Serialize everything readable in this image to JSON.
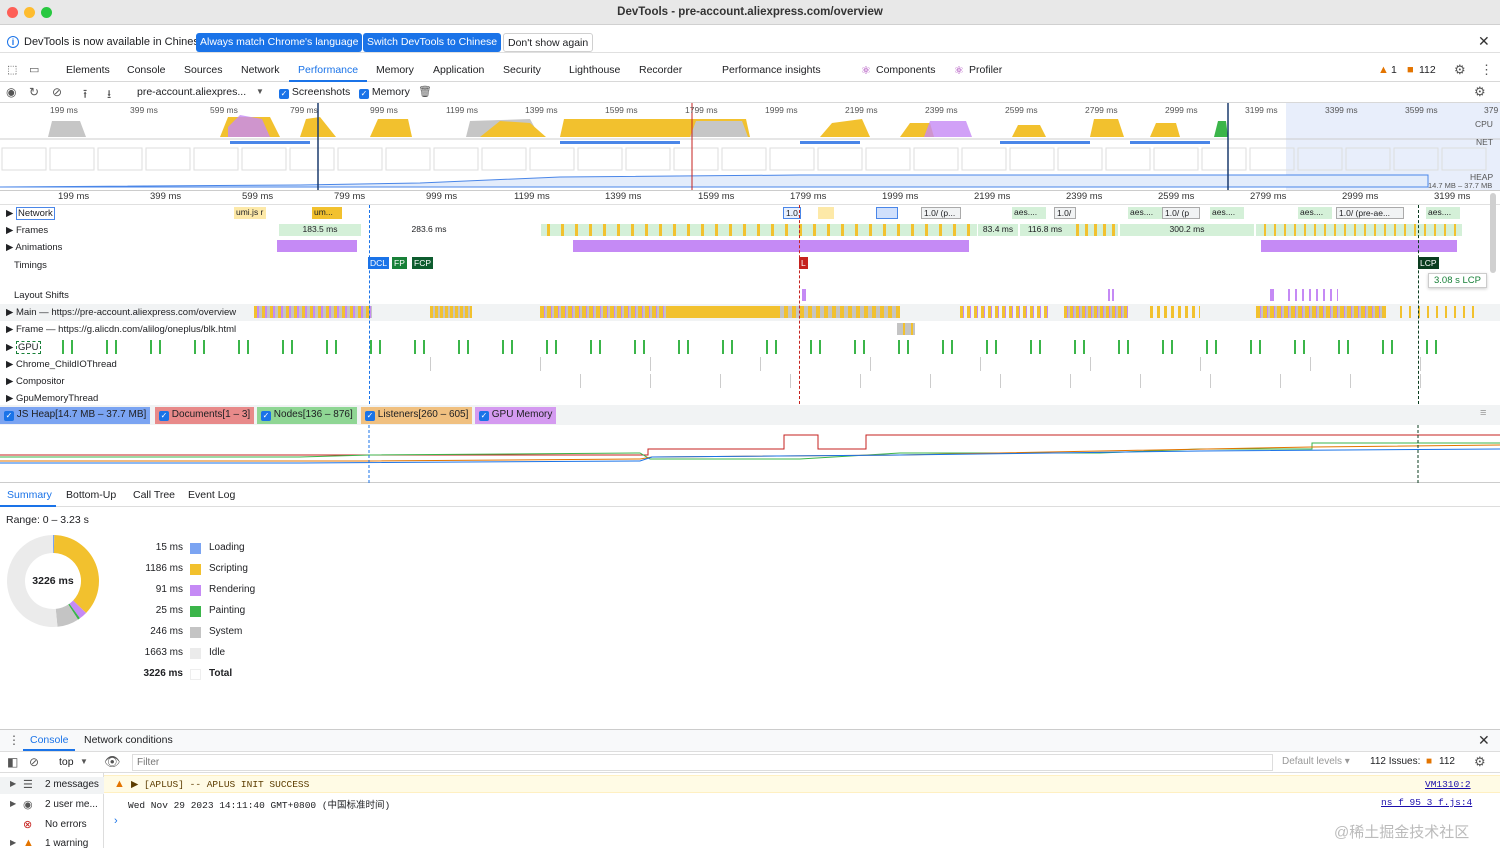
{
  "window": {
    "title": "DevTools - pre-account.aliexpress.com/overview"
  },
  "infobar": {
    "message": "DevTools is now available in Chinese!",
    "btn_match": "Always match Chrome's language",
    "btn_switch": "Switch DevTools to Chinese",
    "btn_dont": "Don't show again"
  },
  "tabs": [
    "Elements",
    "Console",
    "Sources",
    "Network",
    "Performance",
    "Memory",
    "Application",
    "Security",
    "Lighthouse",
    "Recorder",
    "Performance insights",
    "Components",
    "Profiler"
  ],
  "tab_badges": {
    "warnings": "1",
    "issues": "112"
  },
  "perf_toolbar": {
    "recording": "pre-account.aliexpres...",
    "screenshots_label": "Screenshots",
    "memory_label": "Memory"
  },
  "overview": {
    "ticks": [
      "199 ms",
      "399 ms",
      "599 ms",
      "799 ms",
      "999 ms",
      "1199 ms",
      "1399 ms",
      "1599 ms",
      "1799 ms",
      "1999 ms",
      "2199 ms",
      "2399 ms",
      "2599 ms",
      "2799 ms",
      "2999 ms",
      "3199 ms",
      "3399 ms",
      "3599 ms",
      "379"
    ],
    "labels": {
      "cpu": "CPU",
      "net": "NET",
      "heap": "HEAP",
      "heap_range": "14.7 MB – 37.7 MB"
    }
  },
  "timeline": {
    "ticks": [
      "199 ms",
      "399 ms",
      "599 ms",
      "799 ms",
      "999 ms",
      "1199 ms",
      "1399 ms",
      "1599 ms",
      "1799 ms",
      "1999 ms",
      "2199 ms",
      "2399 ms",
      "2599 ms",
      "2799 ms",
      "2999 ms",
      "3199 ms"
    ],
    "tracks": [
      "Network",
      "Frames",
      "Animations",
      "Timings",
      "Layout Shifts",
      "Main — https://pre-account.aliexpress.com/overview",
      "Frame — https://g.alicdn.com/alilog/oneplus/blk.html",
      "GPU",
      "Chrome_ChildIOThread",
      "Compositor",
      "GpuMemoryThread"
    ],
    "network_items": [
      "umi.js r",
      "um...",
      "1.0.",
      "1.0/ (p...",
      "aes....",
      "1.0/",
      "aes....",
      "1.0/ (p",
      "aes....",
      "aes....",
      "1.0/ (pre-ae...",
      "aes...."
    ],
    "frame_times": [
      "183.5 ms",
      "283.6 ms",
      "83.4 ms",
      "116.8 ms",
      "300.2 ms"
    ],
    "timings": {
      "dcl": "DCL",
      "fp": "FP",
      "fcp": "FCP",
      "l": "L",
      "lcp": "LCP",
      "lcp_tooltip": "3.08 s LCP"
    }
  },
  "memory_legend": {
    "js_heap": "JS Heap[14.7 MB – 37.7 MB]",
    "documents": "Documents[1 – 3]",
    "nodes": "Nodes[136 – 876]",
    "listeners": "Listeners[260 – 605]",
    "gpu": "GPU Memory"
  },
  "bottom_tabs": [
    "Summary",
    "Bottom-Up",
    "Call Tree",
    "Event Log"
  ],
  "summary": {
    "range": "Range: 0 – 3.23 s",
    "total_center": "3226 ms",
    "rows": [
      {
        "value": "15 ms",
        "label": "Loading",
        "color": "#7ba4f2"
      },
      {
        "value": "1186 ms",
        "label": "Scripting",
        "color": "#f2c12e"
      },
      {
        "value": "91 ms",
        "label": "Rendering",
        "color": "#c58af5"
      },
      {
        "value": "25 ms",
        "label": "Painting",
        "color": "#3bb54a"
      },
      {
        "value": "246 ms",
        "label": "System",
        "color": "#c4c4c4"
      },
      {
        "value": "1663 ms",
        "label": "Idle",
        "color": "#ebebeb"
      },
      {
        "value": "3226 ms",
        "label": "Total",
        "color": "#ffffff"
      }
    ]
  },
  "drawer": {
    "tabs": [
      "Console",
      "Network conditions"
    ]
  },
  "console_toolbar": {
    "context": "top",
    "filter_placeholder": "Filter",
    "levels": "Default levels ▾",
    "issues_label": "112 Issues:",
    "issues_count": "112"
  },
  "console_sidebar": [
    "2 messages",
    "2 user me...",
    "No errors",
    "1 warning"
  ],
  "console_messages": [
    {
      "text": "▶ [APLUS] -- APLUS INIT SUCCESS",
      "source": "VM1310:2",
      "level": "warning"
    },
    {
      "text": "Wed Nov 29 2023 14:11:40 GMT+0800 (中国标准时间)",
      "source": "ns f 95 3 f.js:4",
      "level": "info"
    }
  ],
  "watermark": "@稀土掘金技术社区"
}
